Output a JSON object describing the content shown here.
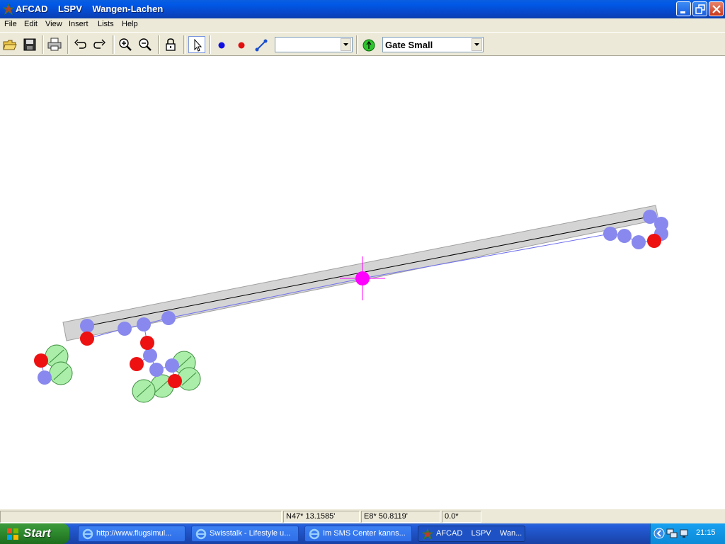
{
  "window": {
    "title": "AFCAD    LSPV    Wangen-Lachen",
    "controls": {
      "minimize": "minimize-icon",
      "restore": "restore-icon",
      "close": "close-icon"
    }
  },
  "menu": [
    "File",
    "Edit",
    "View",
    "Insert",
    "Lists",
    "Help"
  ],
  "toolbar": {
    "buttons": [
      "open-icon",
      "save-icon",
      "print-icon",
      "undo-icon",
      "redo-icon",
      "zoom-in-icon",
      "zoom-out-icon",
      "lock-icon",
      "select-pointer-icon",
      "add-blue-node-icon",
      "add-red-node-icon",
      "add-link-icon",
      "add-parking-icon"
    ],
    "selected_tool": "select-pointer-icon",
    "link_type_value": "",
    "parking_type_value": "Gate Small"
  },
  "status": {
    "message": "",
    "latitude": "N47* 13.1585'",
    "longitude": "E8* 50.8119'",
    "heading": "0.0*"
  },
  "taskbar": {
    "start_label": "Start",
    "tasks": [
      {
        "label": "http://www.flugsimul...",
        "icon": "internet-explorer-icon",
        "active": false
      },
      {
        "label": "Swisstalk - Lifestyle u...",
        "icon": "internet-explorer-icon",
        "active": false
      },
      {
        "label": "Im SMS Center kanns...",
        "icon": "internet-explorer-icon",
        "active": false
      },
      {
        "label": "AFCAD    LSPV    Wan...",
        "icon": "afcad-icon",
        "active": true
      }
    ],
    "clock": "21:15",
    "tray_icons": [
      "show-hidden-icons-icon",
      "network-icon",
      "network-connection-icon"
    ]
  },
  "colors": {
    "taxi_node": "#8888ee",
    "hold_node": "#ee1111",
    "parking_spot": "#aaeeaa",
    "runway": "#d4d4d4",
    "cursor": "#ff00ff"
  }
}
